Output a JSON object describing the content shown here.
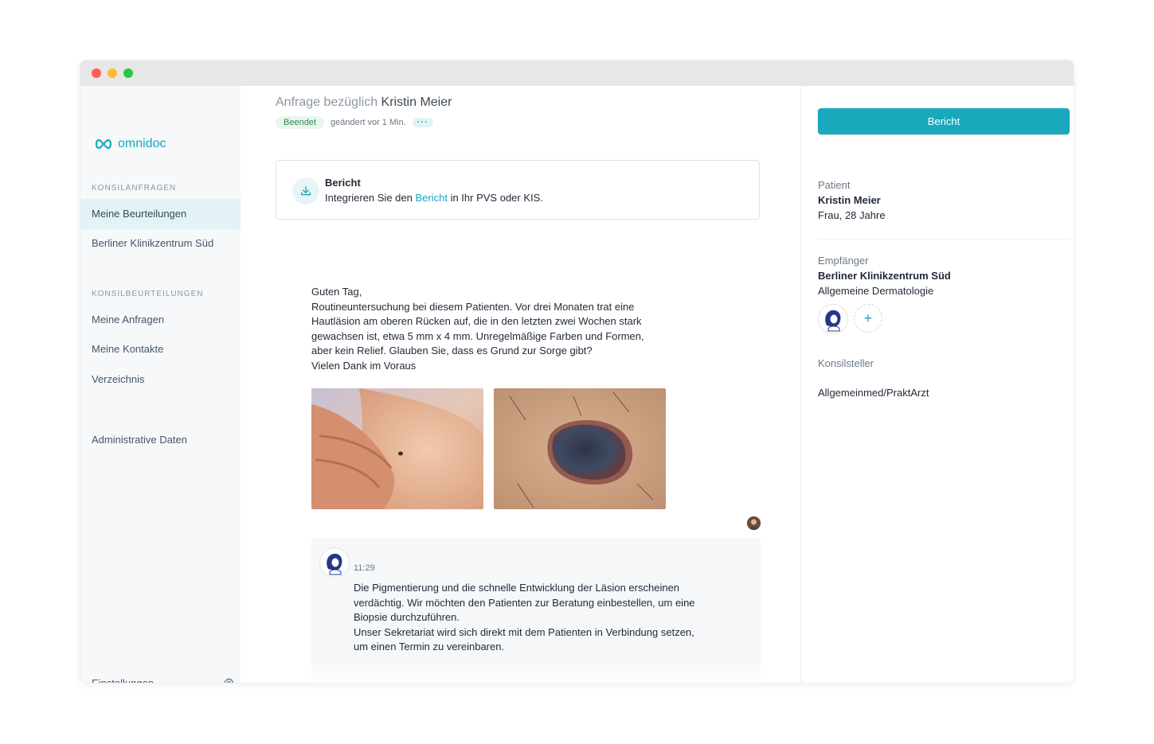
{
  "app": {
    "logo_text": "omnidoc"
  },
  "sidebar": {
    "section1_title": "KONSILANFRAGEN",
    "section1_items": [
      {
        "label": "Meine Beurteilungen",
        "active": true
      },
      {
        "label": "Berliner Klinikzentrum Süd",
        "active": false
      }
    ],
    "section2_title": "KONSILBEURTEILUNGEN",
    "section2_items": [
      {
        "label": "Meine Anfragen"
      },
      {
        "label": "Meine Kontakte"
      },
      {
        "label": "Verzeichnis"
      }
    ],
    "admin_label": "Administrative Daten",
    "settings_label": "Einstellungen"
  },
  "request": {
    "title_prefix": "Anfrage bezüglich",
    "patient_name": "Kristin Meier",
    "status": "Beendet",
    "changed": "geändert vor 1 Min.",
    "more": "···"
  },
  "report_card": {
    "title": "Bericht",
    "text_before": "Integrieren Sie den",
    "link": "Bericht",
    "text_after": "in Ihr PVS oder KIS."
  },
  "message": {
    "lines": [
      "Guten Tag,",
      "Routineuntersuchung bei diesem Patienten. Vor drei Monaten trat eine",
      "Hautläsion am oberen Rücken auf, die in den letzten zwei Wochen stark",
      "gewachsen ist, etwa 5 mm x 4 mm. Unregelmäßige Farben und Formen,",
      "aber kein Relief. Glauben Sie, dass es Grund zur Sorge gibt?",
      "Vielen Dank im Voraus"
    ]
  },
  "reply": {
    "time": "11:29",
    "lines": [
      "Die Pigmentierung und die schnelle Entwicklung der Läsion erscheinen",
      "verdächtig. Wir möchten den Patienten zur Beratung einbestellen, um eine",
      "Biopsie durchzuführen.",
      "Unser Sekretariat wird sich direkt mit dem Patienten in Verbindung setzen,",
      "um einen Termin zu vereinbaren."
    ]
  },
  "panel": {
    "report_button": "Bericht",
    "patient_label": "Patient",
    "patient_name": "Kristin Meier",
    "patient_info": "Frau, 28 Jahre",
    "recipient_label": "Empfänger",
    "recipient_name": "Berliner Klinikzentrum Süd",
    "recipient_dept": "Allgemeine Dermatologie",
    "add_symbol": "+",
    "requester_label": "Konsilsteller",
    "requester_value": "Allgemeinmed/PraktArzt"
  },
  "colors": {
    "accent": "#1aa8bd",
    "badge_green": "#2e8b57"
  }
}
